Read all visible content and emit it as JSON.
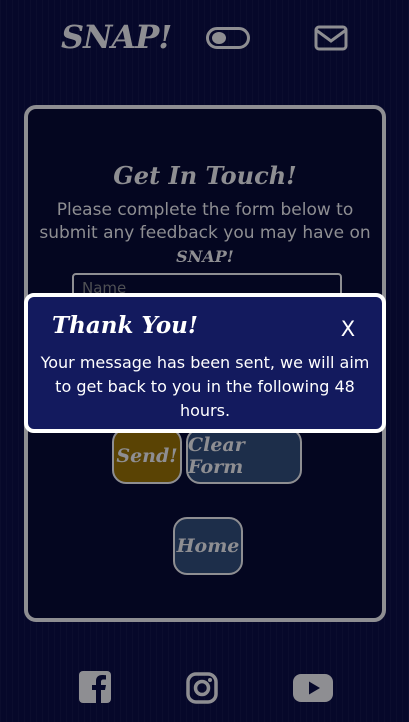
{
  "header": {
    "logo": "SNAP!",
    "theme_toggle_icon": "toggle-switch-icon",
    "contact_icon": "envelope-icon"
  },
  "contact_card": {
    "title": "Get In Touch!",
    "description": "Please complete the form below to submit any feedback you may have on",
    "brand": "SNAP!",
    "name_placeholder": "Name",
    "send_label": "Send!",
    "clear_label": "Clear Form",
    "home_label": "Home"
  },
  "modal": {
    "title": "Thank You!",
    "close_label": "X",
    "message": "Your message has been sent, we will aim to get back to you in the following 48 hours."
  },
  "footer": {
    "icons": [
      "facebook-icon",
      "instagram-icon",
      "youtube-icon"
    ]
  },
  "colors": {
    "background": "#06082a",
    "muted": "#8e8e92",
    "modal_background": "#131a5e",
    "send_button": "#5a4304",
    "secondary_button": "#1d2e4a"
  }
}
